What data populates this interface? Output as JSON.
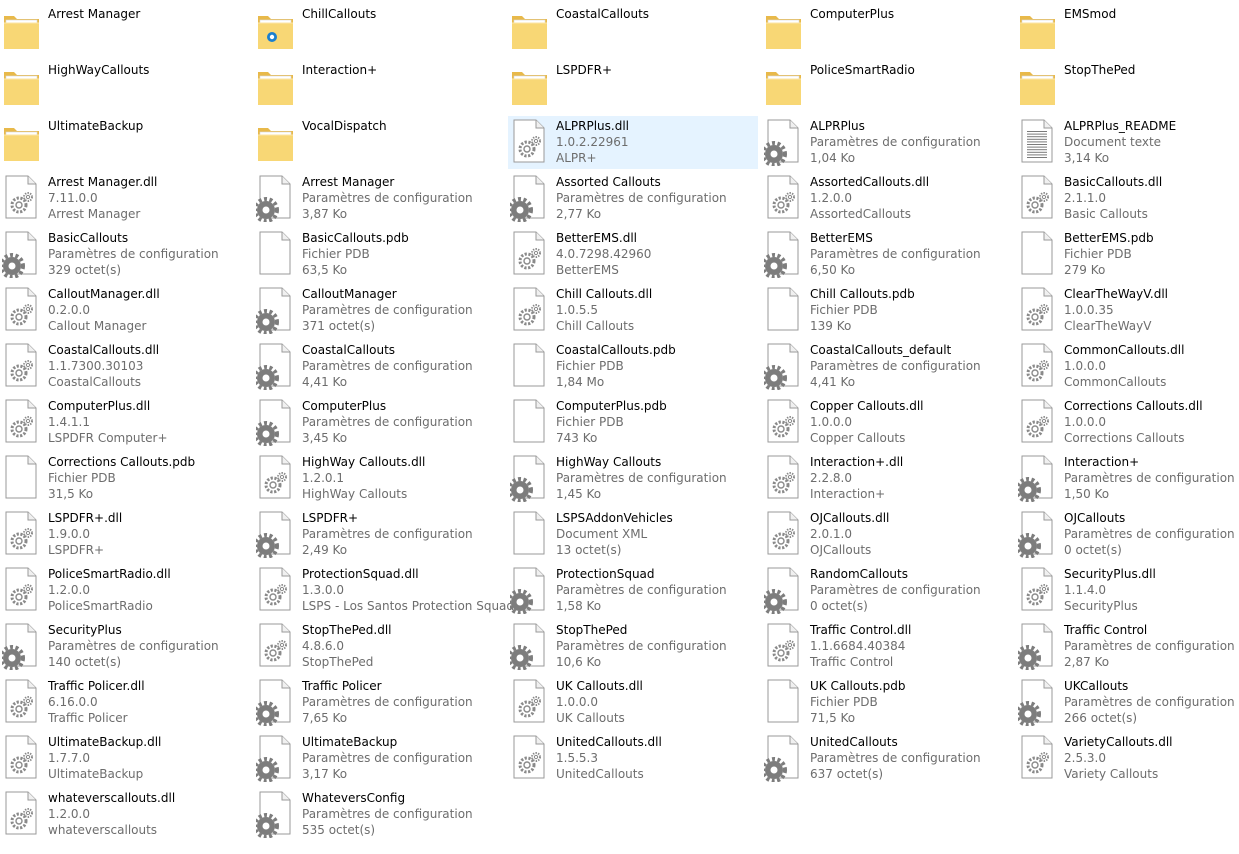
{
  "items": [
    {
      "name": "Arrest Manager",
      "kind": "folder"
    },
    {
      "name": "ChillCallouts",
      "kind": "folder-badge"
    },
    {
      "name": "CoastalCallouts",
      "kind": "folder"
    },
    {
      "name": "ComputerPlus",
      "kind": "folder"
    },
    {
      "name": "EMSmod",
      "kind": "folder"
    },
    {
      "name": "HighWayCallouts",
      "kind": "folder"
    },
    {
      "name": "Interaction+",
      "kind": "folder"
    },
    {
      "name": "LSPDFR+",
      "kind": "folder"
    },
    {
      "name": "PoliceSmartRadio",
      "kind": "folder"
    },
    {
      "name": "StopThePed",
      "kind": "folder"
    },
    {
      "name": "UltimateBackup",
      "kind": "folder"
    },
    {
      "name": "VocalDispatch",
      "kind": "folder"
    },
    {
      "name": "ALPRPlus.dll",
      "kind": "dll",
      "line2": "1.0.2.22961",
      "line3": "ALPR+",
      "selected": true
    },
    {
      "name": "ALPRPlus",
      "kind": "config",
      "line2": "Paramètres de configuration",
      "line3": "1,04 Ko"
    },
    {
      "name": "ALPRPlus_README",
      "kind": "text",
      "line2": "Document texte",
      "line3": "3,14 Ko"
    },
    {
      "name": "Arrest Manager.dll",
      "kind": "dll",
      "line2": "7.11.0.0",
      "line3": "Arrest Manager"
    },
    {
      "name": "Arrest Manager",
      "kind": "config",
      "line2": "Paramètres de configuration",
      "line3": "3,87 Ko"
    },
    {
      "name": "Assorted Callouts",
      "kind": "config",
      "line2": "Paramètres de configuration",
      "line3": "2,77 Ko"
    },
    {
      "name": "AssortedCallouts.dll",
      "kind": "dll",
      "line2": "1.2.0.0",
      "line3": "AssortedCallouts"
    },
    {
      "name": "BasicCallouts.dll",
      "kind": "dll",
      "line2": "2.1.1.0",
      "line3": "Basic Callouts"
    },
    {
      "name": "BasicCallouts",
      "kind": "config",
      "line2": "Paramètres de configuration",
      "line3": "329 octet(s)"
    },
    {
      "name": "BasicCallouts.pdb",
      "kind": "blank",
      "line2": "Fichier PDB",
      "line3": "63,5 Ko"
    },
    {
      "name": "BetterEMS.dll",
      "kind": "dll",
      "line2": "4.0.7298.42960",
      "line3": "BetterEMS"
    },
    {
      "name": "BetterEMS",
      "kind": "config",
      "line2": "Paramètres de configuration",
      "line3": "6,50 Ko"
    },
    {
      "name": "BetterEMS.pdb",
      "kind": "blank",
      "line2": "Fichier PDB",
      "line3": "279 Ko"
    },
    {
      "name": "CalloutManager.dll",
      "kind": "dll",
      "line2": "0.2.0.0",
      "line3": "Callout Manager"
    },
    {
      "name": "CalloutManager",
      "kind": "config",
      "line2": "Paramètres de configuration",
      "line3": "371 octet(s)"
    },
    {
      "name": "Chill Callouts.dll",
      "kind": "dll",
      "line2": "1.0.5.5",
      "line3": "Chill Callouts"
    },
    {
      "name": "Chill Callouts.pdb",
      "kind": "blank",
      "line2": "Fichier PDB",
      "line3": "139 Ko"
    },
    {
      "name": "ClearTheWayV.dll",
      "kind": "dll",
      "line2": "1.0.0.35",
      "line3": "ClearTheWayV"
    },
    {
      "name": "CoastalCallouts.dll",
      "kind": "dll",
      "line2": "1.1.7300.30103",
      "line3": "CoastalCallouts"
    },
    {
      "name": "CoastalCallouts",
      "kind": "config",
      "line2": "Paramètres de configuration",
      "line3": "4,41 Ko"
    },
    {
      "name": "CoastalCallouts.pdb",
      "kind": "blank",
      "line2": "Fichier PDB",
      "line3": "1,84 Mo"
    },
    {
      "name": "CoastalCallouts_default",
      "kind": "config",
      "line2": "Paramètres de configuration",
      "line3": "4,41 Ko"
    },
    {
      "name": "CommonCallouts.dll",
      "kind": "dll",
      "line2": "1.0.0.0",
      "line3": "CommonCallouts"
    },
    {
      "name": "ComputerPlus.dll",
      "kind": "dll",
      "line2": "1.4.1.1",
      "line3": "LSPDFR Computer+"
    },
    {
      "name": "ComputerPlus",
      "kind": "config",
      "line2": "Paramètres de configuration",
      "line3": "3,45 Ko"
    },
    {
      "name": "ComputerPlus.pdb",
      "kind": "blank",
      "line2": "Fichier PDB",
      "line3": "743 Ko"
    },
    {
      "name": "Copper Callouts.dll",
      "kind": "dll",
      "line2": "1.0.0.0",
      "line3": "Copper Callouts"
    },
    {
      "name": "Corrections Callouts.dll",
      "kind": "dll",
      "line2": "1.0.0.0",
      "line3": "Corrections Callouts"
    },
    {
      "name": "Corrections Callouts.pdb",
      "kind": "blank",
      "line2": "Fichier PDB",
      "line3": "31,5 Ko"
    },
    {
      "name": "HighWay Callouts.dll",
      "kind": "dll",
      "line2": "1.2.0.1",
      "line3": "HighWay Callouts"
    },
    {
      "name": "HighWay Callouts",
      "kind": "config",
      "line2": "Paramètres de configuration",
      "line3": "1,45 Ko"
    },
    {
      "name": "Interaction+.dll",
      "kind": "dll",
      "line2": "2.2.8.0",
      "line3": "Interaction+"
    },
    {
      "name": "Interaction+",
      "kind": "config",
      "line2": "Paramètres de configuration",
      "line3": "1,50 Ko"
    },
    {
      "name": "LSPDFR+.dll",
      "kind": "dll",
      "line2": "1.9.0.0",
      "line3": "LSPDFR+"
    },
    {
      "name": "LSPDFR+",
      "kind": "config",
      "line2": "Paramètres de configuration",
      "line3": "2,49 Ko"
    },
    {
      "name": "LSPSAddonVehicles",
      "kind": "blank",
      "line2": "Document XML",
      "line3": "13 octet(s)"
    },
    {
      "name": "OJCallouts.dll",
      "kind": "dll",
      "line2": "2.0.1.0",
      "line3": "OJCallouts"
    },
    {
      "name": "OJCallouts",
      "kind": "config",
      "line2": "Paramètres de configuration",
      "line3": "0 octet(s)"
    },
    {
      "name": "PoliceSmartRadio.dll",
      "kind": "dll",
      "line2": "1.2.0.0",
      "line3": "PoliceSmartRadio"
    },
    {
      "name": "ProtectionSquad.dll",
      "kind": "dll",
      "line2": "1.3.0.0",
      "line3": "LSPS - Los Santos Protection Squad"
    },
    {
      "name": "ProtectionSquad",
      "kind": "config",
      "line2": "Paramètres de configuration",
      "line3": "1,58 Ko"
    },
    {
      "name": "RandomCallouts",
      "kind": "config",
      "line2": "Paramètres de configuration",
      "line3": "0 octet(s)"
    },
    {
      "name": "SecurityPlus.dll",
      "kind": "dll",
      "line2": "1.1.4.0",
      "line3": "SecurityPlus"
    },
    {
      "name": "SecurityPlus",
      "kind": "config",
      "line2": "Paramètres de configuration",
      "line3": "140 octet(s)"
    },
    {
      "name": "StopThePed.dll",
      "kind": "dll",
      "line2": "4.8.6.0",
      "line3": "StopThePed"
    },
    {
      "name": "StopThePed",
      "kind": "config",
      "line2": "Paramètres de configuration",
      "line3": "10,6 Ko"
    },
    {
      "name": "Traffic Control.dll",
      "kind": "dll",
      "line2": "1.1.6684.40384",
      "line3": "Traffic Control"
    },
    {
      "name": "Traffic Control",
      "kind": "config",
      "line2": "Paramètres de configuration",
      "line3": "2,87 Ko"
    },
    {
      "name": "Traffic Policer.dll",
      "kind": "dll",
      "line2": "6.16.0.0",
      "line3": "Traffic Policer"
    },
    {
      "name": "Traffic Policer",
      "kind": "config",
      "line2": "Paramètres de configuration",
      "line3": "7,65 Ko"
    },
    {
      "name": "UK Callouts.dll",
      "kind": "dll",
      "line2": "1.0.0.0",
      "line3": "UK Callouts"
    },
    {
      "name": "UK Callouts.pdb",
      "kind": "blank",
      "line2": "Fichier PDB",
      "line3": "71,5 Ko"
    },
    {
      "name": "UKCallouts",
      "kind": "config",
      "line2": "Paramètres de configuration",
      "line3": "266 octet(s)"
    },
    {
      "name": "UltimateBackup.dll",
      "kind": "dll",
      "line2": "1.7.7.0",
      "line3": "UltimateBackup"
    },
    {
      "name": "UltimateBackup",
      "kind": "config",
      "line2": "Paramètres de configuration",
      "line3": "3,17 Ko"
    },
    {
      "name": "UnitedCallouts.dll",
      "kind": "dll",
      "line2": "1.5.5.3",
      "line3": "UnitedCallouts"
    },
    {
      "name": "UnitedCallouts",
      "kind": "config",
      "line2": "Paramètres de configuration",
      "line3": "637 octet(s)"
    },
    {
      "name": "VarietyCallouts.dll",
      "kind": "dll",
      "line2": "2.5.3.0",
      "line3": "Variety Callouts"
    },
    {
      "name": "whateverscallouts.dll",
      "kind": "dll",
      "line2": "1.2.0.0",
      "line3": "whateverscallouts"
    },
    {
      "name": "WhateversConfig",
      "kind": "config",
      "line2": "Paramètres de configuration",
      "line3": "535 octet(s)"
    }
  ],
  "colors": {
    "folder_back": "#e8b94a",
    "folder_front": "#f8d775",
    "selection": "#e5f3ff",
    "secondary_text": "#6d6d6d"
  }
}
